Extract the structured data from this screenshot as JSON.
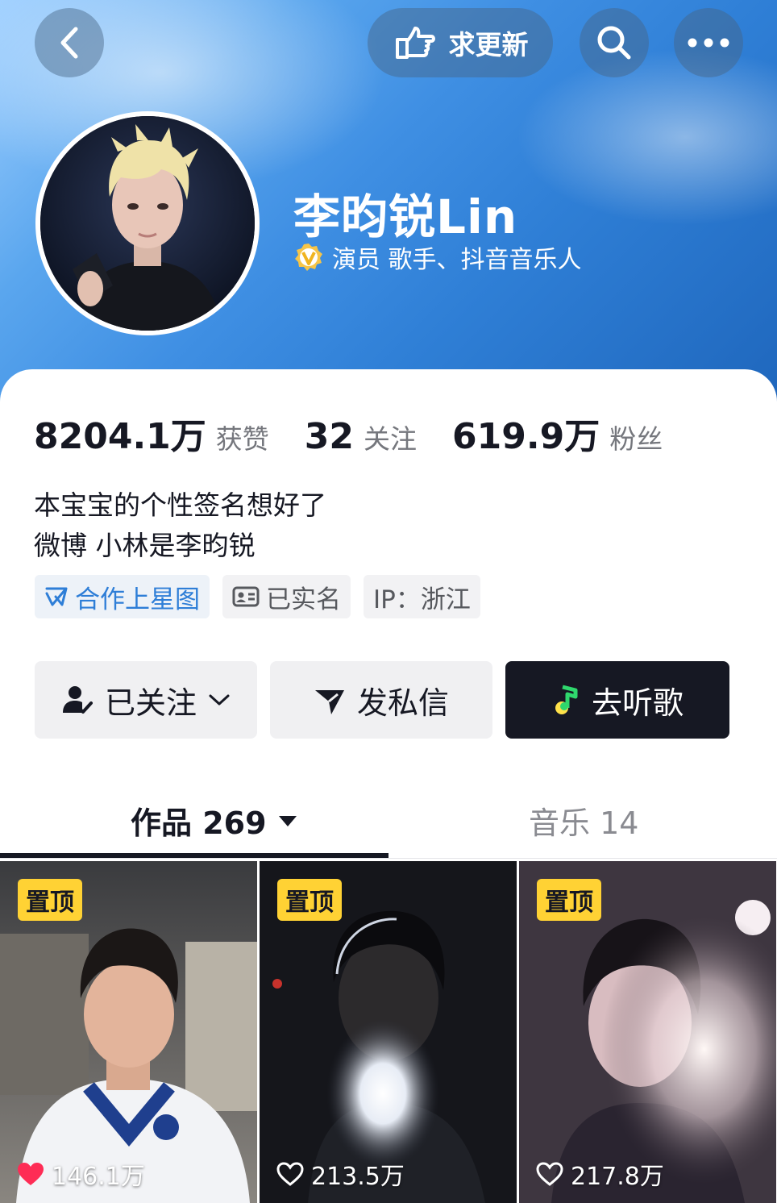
{
  "colors": {
    "accent_blue": "#2e7ed7",
    "pin_yellow": "#ffd234",
    "dark_button": "#161823",
    "like_red": "#fe2c55"
  },
  "header": {
    "back_icon": "chevron-left-icon",
    "request_update_label": "求更新",
    "search_icon": "search-icon",
    "more_icon": "more-icon"
  },
  "profile": {
    "name": "李昀锐Lin",
    "verification_text": "演员 歌手、抖音音乐人",
    "verified_icon": "verified-badge-icon"
  },
  "stats": [
    {
      "value": "8204.1万",
      "label": "获赞"
    },
    {
      "value": "32",
      "label": "关注"
    },
    {
      "value": "619.9万",
      "label": "粉丝"
    }
  ],
  "bio": {
    "line1": "本宝宝的个性签名想好了",
    "line2": "微博 小林是李昀锐"
  },
  "tags": [
    {
      "label": "合作上星图",
      "icon": "star-map-icon"
    },
    {
      "label": "已实名",
      "icon": "id-card-icon"
    },
    {
      "label": "IP：浙江"
    }
  ],
  "actions": {
    "follow_label": "已关注",
    "message_label": "发私信",
    "music_label": "去听歌"
  },
  "tabs": {
    "works_label": "作品 269",
    "music_label": "音乐 14"
  },
  "videos": [
    {
      "pin_label": "置顶",
      "likes": "146.1万",
      "liked": true
    },
    {
      "pin_label": "置顶",
      "likes": "213.5万",
      "liked": false
    },
    {
      "pin_label": "置顶",
      "likes": "217.8万",
      "liked": false
    }
  ]
}
